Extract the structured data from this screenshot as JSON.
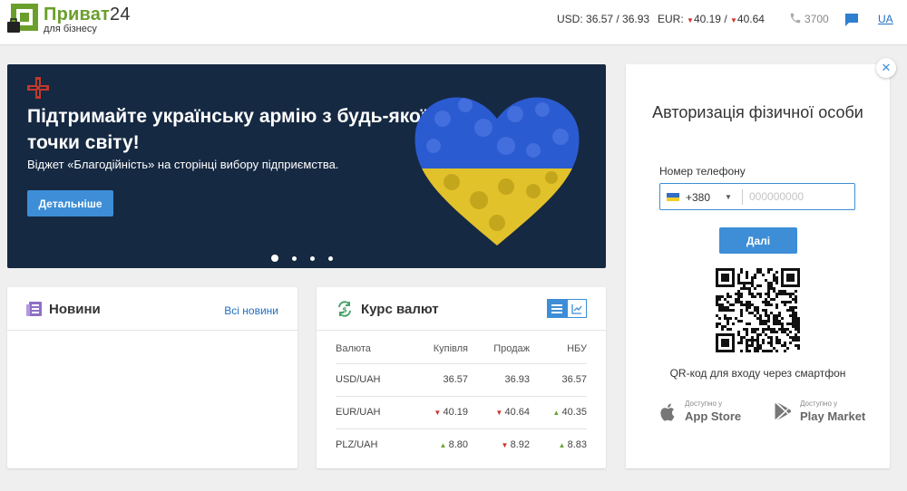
{
  "header": {
    "logo_brand": "Приват",
    "logo_num": "24",
    "logo_sub": "для бізнесу",
    "usd_label": "USD:",
    "usd_value": "36.57 / 36.93",
    "eur_label": "EUR:",
    "eur_buy": "40.19",
    "eur_sep": "/",
    "eur_sell": "40.64",
    "phone": "3700",
    "language": "UA"
  },
  "banner": {
    "title": "Підтримайте українську армію з будь-якої точки світу!",
    "subtitle": "Віджет «Благодійність» на сторінці вибору підприємства.",
    "button": "Детальніше",
    "slide_count": 4,
    "active_slide": 1
  },
  "news": {
    "title": "Новини",
    "all_link": "Всі новини"
  },
  "rates": {
    "title": "Курс валют",
    "columns": [
      "Валюта",
      "Купівля",
      "Продаж",
      "НБУ"
    ],
    "rows": [
      {
        "pair": "USD/UAH",
        "buy": "36.57",
        "buy_trend": "",
        "sell": "36.93",
        "sell_trend": "",
        "nbu": "36.57",
        "nbu_trend": ""
      },
      {
        "pair": "EUR/UAH",
        "buy": "40.19",
        "buy_trend": "down",
        "sell": "40.64",
        "sell_trend": "down",
        "nbu": "40.35",
        "nbu_trend": "up"
      },
      {
        "pair": "PLZ/UAH",
        "buy": "8.80",
        "buy_trend": "up",
        "sell": "8.92",
        "sell_trend": "down",
        "nbu": "8.83",
        "nbu_trend": "up"
      }
    ]
  },
  "login": {
    "title": "Авторизація фізичної особи",
    "phone_label": "Номер телефону",
    "country_code": "+380",
    "phone_placeholder": "000000000",
    "next_button": "Далі",
    "qr_caption": "QR-код для входу через смартфон",
    "appstore_small": "Доступно у",
    "appstore_big": "App Store",
    "play_small": "Доступно у",
    "play_big": "Play Market",
    "close_symbol": "✕"
  },
  "colors": {
    "accent": "#3d8ed6",
    "brand_green": "#6a9f2c",
    "banner_bg": "#162942",
    "trend_down": "#d0312d",
    "trend_up": "#6ba33a"
  }
}
